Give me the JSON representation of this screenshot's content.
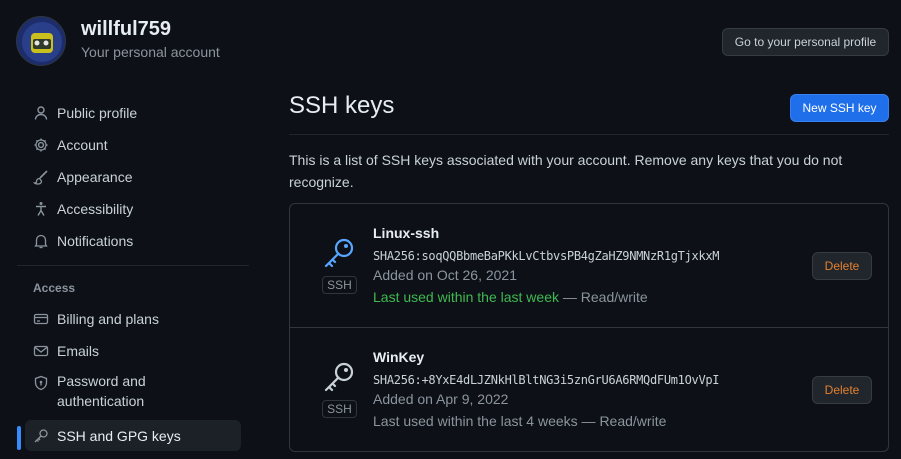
{
  "header": {
    "username": "willful759",
    "subtitle": "Your personal account",
    "profile_button": "Go to your personal profile"
  },
  "sidebar": {
    "items": [
      {
        "label": "Public profile",
        "icon": "person-icon"
      },
      {
        "label": "Account",
        "icon": "gear-icon"
      },
      {
        "label": "Appearance",
        "icon": "paintbrush-icon"
      },
      {
        "label": "Accessibility",
        "icon": "accessibility-icon"
      },
      {
        "label": "Notifications",
        "icon": "bell-icon"
      }
    ],
    "access_heading": "Access",
    "access_items": [
      {
        "label": "Billing and plans",
        "icon": "credit-card-icon"
      },
      {
        "label": "Emails",
        "icon": "mail-icon"
      },
      {
        "label": "Password and authentication",
        "icon": "shield-lock-icon"
      },
      {
        "label": "SSH and GPG keys",
        "icon": "key-icon",
        "active": true
      }
    ]
  },
  "main": {
    "title": "SSH keys",
    "new_button": "New SSH key",
    "description": "This is a list of SSH keys associated with your account. Remove any keys that you do not recognize.",
    "keys": [
      {
        "title": "Linux-ssh",
        "type": "SSH",
        "fingerprint": "SHA256:soqQQBbmeBaPKkLvCtbvsPB4gZaHZ9NMNzR1gTjxkxM",
        "added": "Added on Oct 26, 2021",
        "last_used": "Last used within the last week",
        "access": " — Read/write",
        "recent": true,
        "delete_label": "Delete",
        "icon_color": "#58a6ff"
      },
      {
        "title": "WinKey",
        "type": "SSH",
        "fingerprint": "SHA256:+8YxE4dLJZNkHlBltNG3i5znGrU6A6RMQdFUm1OvVpI",
        "added": "Added on Apr 9, 2022",
        "last_used": "Last used within the last 4 weeks",
        "access": " — Read/write",
        "recent": false,
        "delete_label": "Delete",
        "icon_color": "#c9d1d9"
      }
    ]
  },
  "colors": {
    "background": "#0d1117",
    "accent": "#1f6feb",
    "success": "#3fb950",
    "danger_text": "#e3802f"
  }
}
